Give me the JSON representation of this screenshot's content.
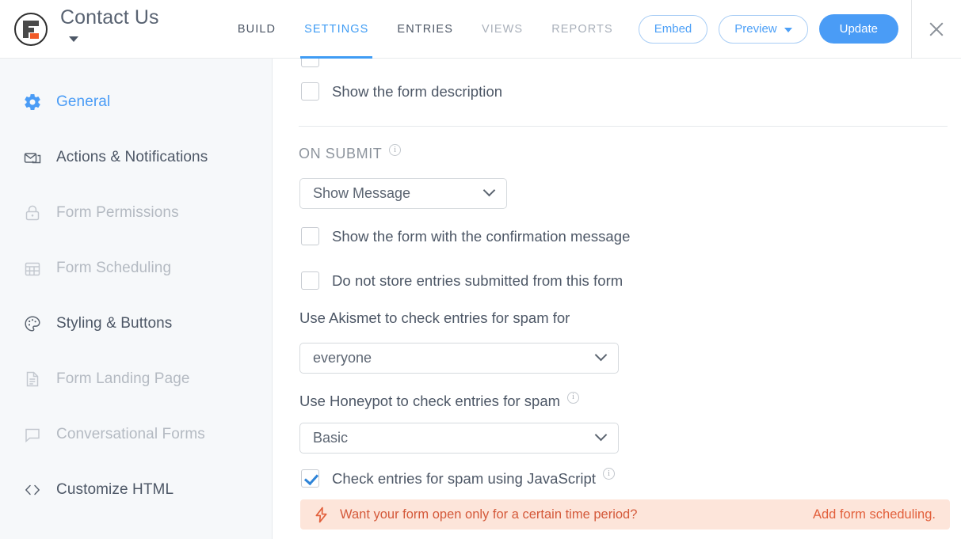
{
  "header": {
    "logo_icon": "formidable-logo-icon",
    "form_title": "Contact Us",
    "title_caret_icon": "chevron-down-icon",
    "tabs": [
      {
        "label": "BUILD",
        "state": "default"
      },
      {
        "label": "SETTINGS",
        "state": "active"
      },
      {
        "label": "ENTRIES",
        "state": "default"
      },
      {
        "label": "VIEWS",
        "state": "muted"
      },
      {
        "label": "REPORTS",
        "state": "muted"
      }
    ],
    "embed_label": "Embed",
    "preview_label": "Preview",
    "preview_caret_icon": "chevron-down-icon",
    "update_label": "Update",
    "close_icon": "close-icon",
    "accent_color": "#4a9cf6"
  },
  "sidebar": {
    "items": [
      {
        "label": "General",
        "icon": "gear-icon",
        "state": "active"
      },
      {
        "label": "Actions & Notifications",
        "icon": "mail-stack-icon",
        "state": "default"
      },
      {
        "label": "Form Permissions",
        "icon": "lock-icon",
        "state": "disabled"
      },
      {
        "label": "Form Scheduling",
        "icon": "calendar-icon",
        "state": "disabled"
      },
      {
        "label": "Styling & Buttons",
        "icon": "palette-icon",
        "state": "default"
      },
      {
        "label": "Form Landing Page",
        "icon": "document-icon",
        "state": "disabled"
      },
      {
        "label": "Conversational Forms",
        "icon": "chat-bubble-icon",
        "state": "disabled"
      },
      {
        "label": "Customize HTML",
        "icon": "code-brackets-icon",
        "state": "default"
      }
    ]
  },
  "main": {
    "show_description": {
      "label": "Show the form description",
      "checked": false
    },
    "on_submit": {
      "heading": "ON SUBMIT",
      "info_icon": "info-icon",
      "select_value": "Show Message",
      "chevron_icon": "chevron-down-icon"
    },
    "show_form_with_confirmation": {
      "label": "Show the form with the confirmation message",
      "checked": false
    },
    "do_not_store_entries": {
      "label": "Do not store entries submitted from this form",
      "checked": false
    },
    "akismet": {
      "label": "Use Akismet to check entries for spam for",
      "select_value": "everyone",
      "chevron_icon": "chevron-down-icon"
    },
    "honeypot": {
      "label": "Use Honeypot to check entries for spam",
      "info_icon": "info-icon",
      "select_value": "Basic",
      "chevron_icon": "chevron-down-icon"
    },
    "javascript_spam": {
      "label": "Check entries for spam using JavaScript",
      "info_icon": "info-icon",
      "checked": true
    },
    "notice": {
      "icon": "lightning-bolt-icon",
      "text": "Want your form open only for a certain time period?",
      "link_label": "Add form scheduling.",
      "background_color": "#fde5da",
      "text_color": "#d4593a"
    }
  }
}
